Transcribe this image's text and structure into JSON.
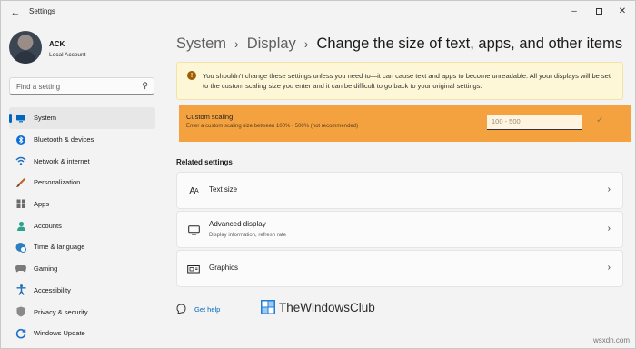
{
  "window": {
    "title": "Settings",
    "controls": [
      "minimize",
      "maximize",
      "close"
    ]
  },
  "profile": {
    "name": "ACK",
    "account_type": "Local Account"
  },
  "search": {
    "placeholder": "Find a setting"
  },
  "sidebar": {
    "items": [
      {
        "label": "System",
        "icon": "system-icon",
        "active": true
      },
      {
        "label": "Bluetooth & devices",
        "icon": "bluetooth-icon"
      },
      {
        "label": "Network & internet",
        "icon": "wifi-icon"
      },
      {
        "label": "Personalization",
        "icon": "brush-icon"
      },
      {
        "label": "Apps",
        "icon": "apps-icon"
      },
      {
        "label": "Accounts",
        "icon": "person-icon"
      },
      {
        "label": "Time & language",
        "icon": "globe-clock-icon"
      },
      {
        "label": "Gaming",
        "icon": "gamepad-icon"
      },
      {
        "label": "Accessibility",
        "icon": "accessibility-icon"
      },
      {
        "label": "Privacy & security",
        "icon": "shield-icon"
      },
      {
        "label": "Windows Update",
        "icon": "update-icon"
      }
    ]
  },
  "breadcrumb": {
    "items": [
      "System",
      "Display"
    ],
    "current": "Change the size of text, apps, and other items"
  },
  "warning": {
    "text": "You shouldn't change these settings unless you need to—it can cause text and apps to become unreadable. All your displays will be set to the custom scaling size you enter and it can be difficult to go back to your original settings."
  },
  "custom_scaling": {
    "title": "Custom scaling",
    "description": "Enter a custom scaling size between 100% - 500% (not recommended)",
    "placeholder": "100 - 500",
    "accent_color": "#f4a240"
  },
  "related": {
    "heading": "Related settings",
    "items": [
      {
        "label": "Text size",
        "icon": "text-size-icon"
      },
      {
        "label": "Advanced display",
        "sub": "Display information, refresh rate",
        "icon": "monitor-icon"
      },
      {
        "label": "Graphics",
        "icon": "graphics-icon"
      }
    ]
  },
  "help": {
    "label": "Get help"
  },
  "watermark": {
    "text": "TheWindowsClub"
  },
  "corner_text": "wsxdn.com",
  "colors": {
    "accent": "#0067c0",
    "warning_bg": "#fdf6d7"
  }
}
